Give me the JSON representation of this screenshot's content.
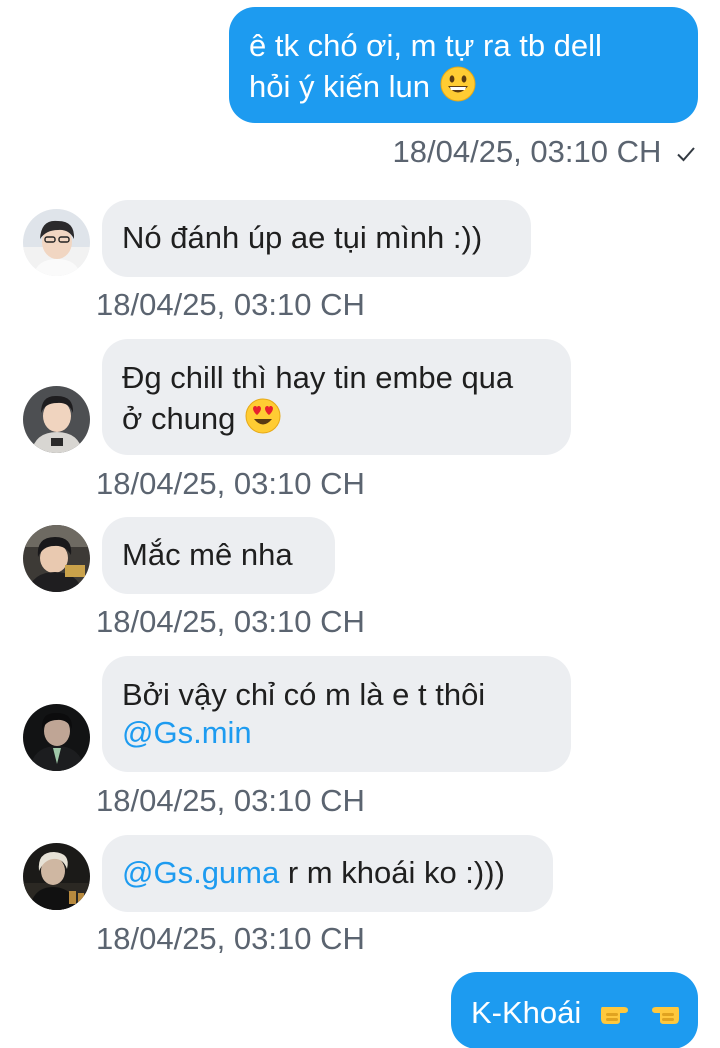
{
  "conversation": {
    "messages": [
      {
        "direction": "outgoing",
        "lines": [
          "ê tk chó ơi, m tự ra tb dell",
          "hỏi ý kiến lun"
        ],
        "emoji": "grinning-face",
        "timestamp": "18/04/25, 03:10 CH",
        "status": "sent-check"
      },
      {
        "direction": "incoming",
        "text": "Nó đánh úp ae tụi mình :))",
        "timestamp": "18/04/25, 03:10 CH"
      },
      {
        "direction": "incoming",
        "lines": [
          "Đg chill thì hay tin embe qua",
          "ở chung"
        ],
        "emoji": "heart-eyes-face",
        "timestamp": "18/04/25, 03:10 CH"
      },
      {
        "direction": "incoming",
        "text": "Mắc mê nha",
        "timestamp": "18/04/25, 03:10 CH"
      },
      {
        "direction": "incoming",
        "line1": "Bởi vậy chỉ có m là e t thôi",
        "mention": "@Gs.min",
        "timestamp": "18/04/25, 03:10 CH"
      },
      {
        "direction": "incoming",
        "mention": "@Gs.guma",
        "text": " r m khoái ko :)))",
        "timestamp": "18/04/25, 03:10 CH"
      },
      {
        "direction": "outgoing",
        "text": "K-Khoái",
        "emoji": "pointing-hands"
      }
    ]
  },
  "colors": {
    "outgoing_bubble": "#1d9bf0",
    "incoming_bubble": "#eceef1",
    "mention": "#1d9bf0",
    "timestamp": "#5b6470"
  }
}
